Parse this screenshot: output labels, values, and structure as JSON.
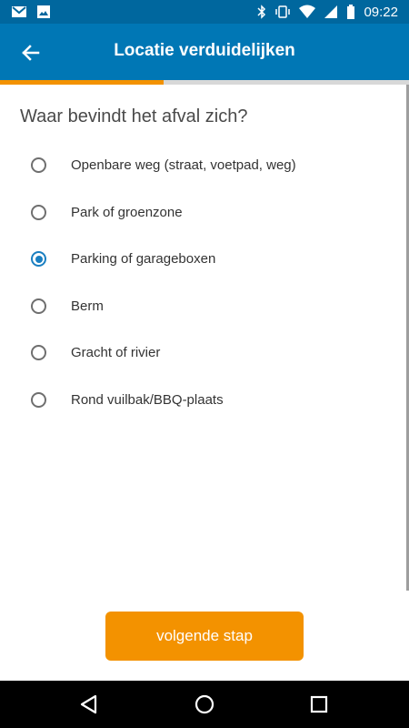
{
  "status_bar": {
    "time": "09:22",
    "left_icons": [
      "gmail-icon",
      "image-icon"
    ],
    "right_icons": [
      "bluetooth-icon",
      "vibrate-icon",
      "wifi-icon",
      "signal-icon",
      "battery-icon"
    ]
  },
  "app_bar": {
    "title": "Locatie verduidelijken",
    "back_icon": "arrow-left-icon"
  },
  "progress": {
    "fraction": 0.4
  },
  "question": "Waar bevindt het afval zich?",
  "options": [
    {
      "label": "Openbare weg (straat, voetpad, weg)",
      "selected": false
    },
    {
      "label": "Park of groenzone",
      "selected": false
    },
    {
      "label": "Parking of garageboxen",
      "selected": true
    },
    {
      "label": "Berm",
      "selected": false
    },
    {
      "label": "Gracht of rivier",
      "selected": false
    },
    {
      "label": "Rond vuilbak/BBQ-plaats",
      "selected": false
    }
  ],
  "next_button": {
    "label": "volgende stap"
  },
  "nav_bar": {
    "icons": [
      "back-triangle-icon",
      "home-circle-icon",
      "recents-square-icon"
    ]
  },
  "colors": {
    "primary": "#0077b5",
    "primary_dark": "#00679e",
    "accent": "#f39200",
    "radio_selected": "#1a7fc1"
  }
}
